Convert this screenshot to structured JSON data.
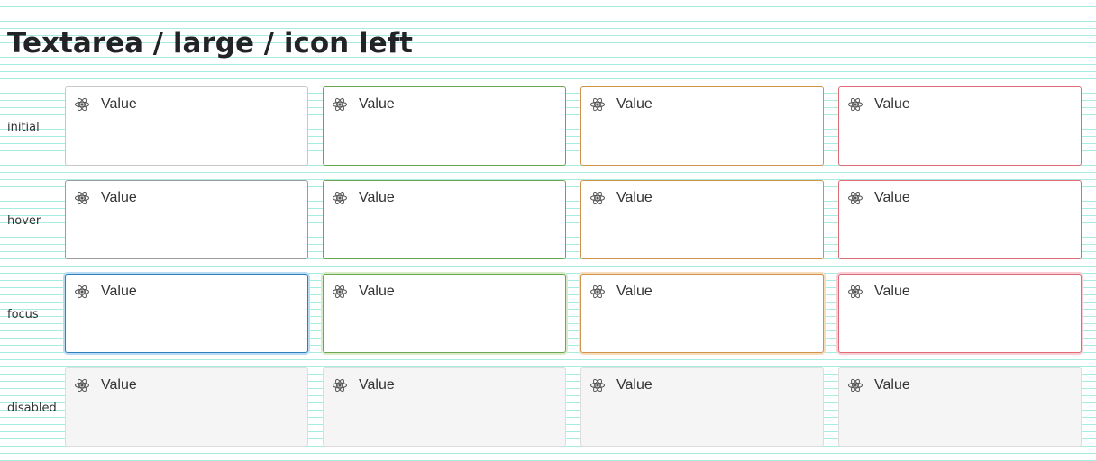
{
  "title": "Textarea / large / icon left",
  "row_labels": [
    "initial",
    "hover",
    "focus",
    "disabled"
  ],
  "field_value": "Value",
  "field_icon": "atom-icon",
  "variants": [
    "default",
    "success",
    "warning",
    "error"
  ],
  "colors": {
    "default_border": "#c8c8c8",
    "hover_border": "#9c9c9c",
    "focus_border": "#2f7fbf",
    "success_border": "#6da553",
    "warning_border": "#d0934a",
    "error_border": "#dd6a74",
    "disabled_background": "#f5f5f5",
    "guide_lines": "#a6ece0"
  }
}
